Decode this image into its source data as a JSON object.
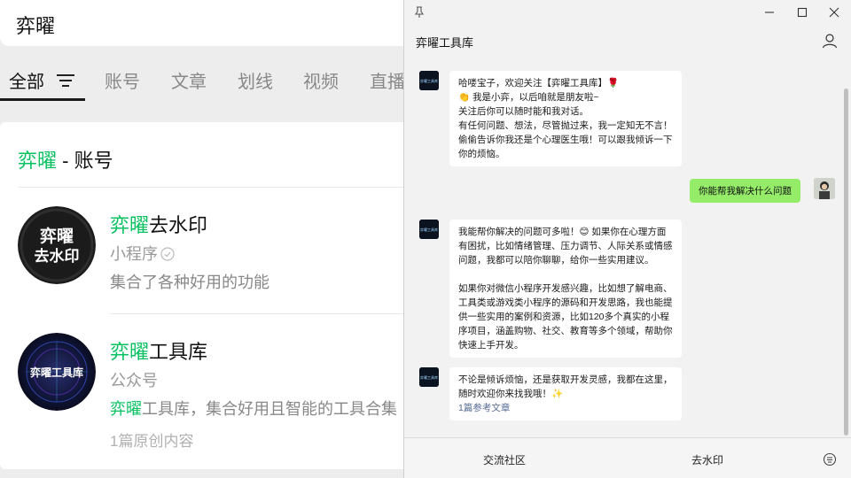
{
  "search": {
    "query": "弈曜",
    "tabs": [
      "全部",
      "账号",
      "文章",
      "划线",
      "视频",
      "直播"
    ]
  },
  "results": {
    "section_title_hl": "弈曜",
    "section_title_rest": " - 账号",
    "items": [
      {
        "avatar_text_line1": "弈曜",
        "avatar_text_line2": "去水印",
        "title_hl": "弈曜",
        "title_rest": "去水印",
        "type": "小程序",
        "desc": "集合了各种好用的功能"
      },
      {
        "avatar_text_line1": "弈曜工具库",
        "title_hl": "弈曜",
        "title_rest": "工具库",
        "type": "公众号",
        "desc_hl": "弈曜",
        "desc_rest": "工具库，集合好用且智能的工具合集",
        "meta": "1篇原创内容"
      }
    ]
  },
  "chat": {
    "title": "弈曜工具库",
    "bot_avatar_text": "弈曜工具库",
    "messages": [
      {
        "from": "bot",
        "lines": [
          "哈喽宝子，欢迎关注【弈曜工具库】🌹",
          "👏 我是小弈，以后咱就是朋友啦~",
          "关注后你可以随时能和我对话。",
          "有任何问题、想法，尽管抛过来，我一定知无不言！",
          "偷偷告诉你我还是个心理医生哦！可以跟我倾诉一下",
          "你的烦恼。"
        ]
      },
      {
        "from": "user",
        "text": "你能帮我解决什么问题"
      },
      {
        "from": "bot",
        "lines": [
          "我能帮你解决的问题可多啦！😊 如果你在心理方面",
          "有困扰，比如情绪管理、压力调节、人际关系或情感",
          "问题，我都可以陪你聊聊，给你一些实用建议。",
          "",
          "如果你对微信小程序开发感兴趣，比如想了解电商、",
          "工具类或游戏类小程序的源码和开发思路，我也能提",
          "供一些实用的案例和资源，比如120多个真实的小程",
          "序项目，涵盖购物、社交、教育等多个领域，帮助你",
          "快速上手开发。"
        ]
      },
      {
        "from": "bot",
        "lines": [
          "不论是倾诉烦恼，还是获取开发灵感，我都在这里，",
          "随时欢迎你来找我哦！✨"
        ],
        "link": "1篇参考文章"
      }
    ],
    "footer": [
      "交流社区",
      "去水印"
    ]
  },
  "colors": {
    "highlight": "#07c160",
    "user_bubble": "#95ec69",
    "link": "#576b95"
  }
}
